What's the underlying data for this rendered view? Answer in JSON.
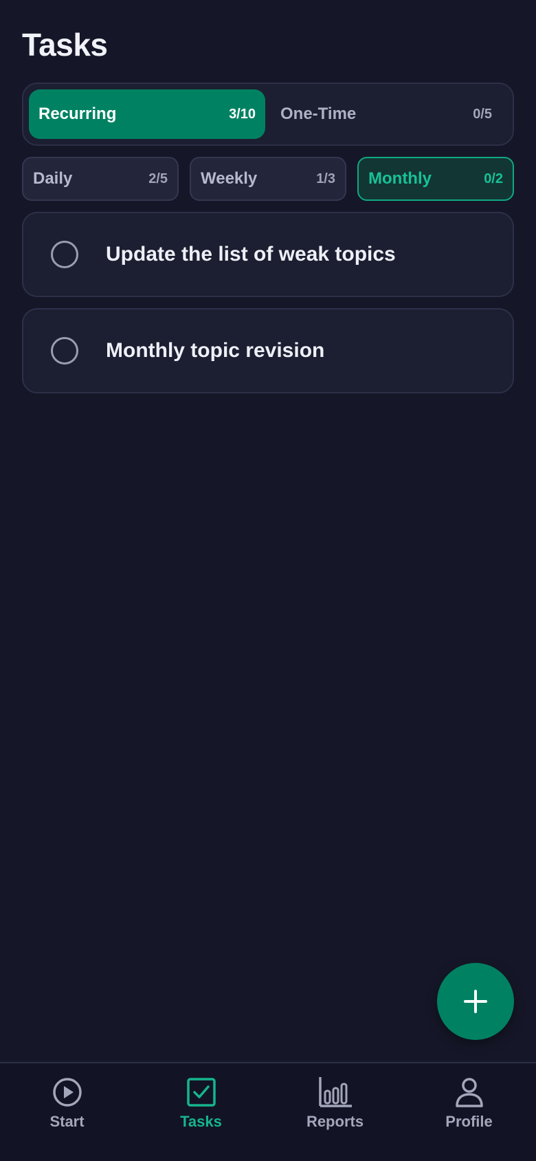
{
  "page": {
    "title": "Tasks"
  },
  "main_tabs": [
    {
      "label": "Recurring",
      "count": "3/10",
      "active": true
    },
    {
      "label": "One-Time",
      "count": "0/5",
      "active": false
    }
  ],
  "sub_tabs": [
    {
      "label": "Daily",
      "count": "2/5",
      "active": false
    },
    {
      "label": "Weekly",
      "count": "1/3",
      "active": false
    },
    {
      "label": "Monthly",
      "count": "0/2",
      "active": true
    }
  ],
  "tasks": [
    {
      "text": "Update the list of weak topics",
      "done": false
    },
    {
      "text": "Monthly topic revision",
      "done": false
    }
  ],
  "fab": {
    "icon": "plus-icon"
  },
  "nav": [
    {
      "label": "Start",
      "icon": "play-circle-icon",
      "active": false
    },
    {
      "label": "Tasks",
      "icon": "checkbox-icon",
      "active": true
    },
    {
      "label": "Reports",
      "icon": "bar-chart-icon",
      "active": false
    },
    {
      "label": "Profile",
      "icon": "user-icon",
      "active": false
    }
  ],
  "colors": {
    "background": "#151728",
    "accent": "#008262",
    "accent_text": "#18c196",
    "card": "#1c1e31"
  }
}
